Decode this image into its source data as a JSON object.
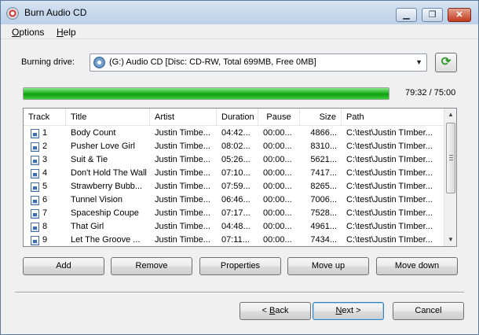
{
  "window": {
    "title": "Burn Audio CD",
    "controls": {
      "minimize": "▁",
      "maximize": "❐",
      "close": "✕"
    }
  },
  "menu": {
    "items": [
      {
        "label": "Options",
        "accel": "O",
        "rest": "ptions"
      },
      {
        "label": "Help",
        "accel": "H",
        "rest": "elp"
      }
    ]
  },
  "drive": {
    "label": "Burning drive:",
    "selected": "(G:) Audio CD [Disc: CD-RW, Total 699MB, Free 0MB]",
    "refresh_icon": "refresh-icon"
  },
  "progress": {
    "fraction": 1.0,
    "time_text": "79:32 / 75:00"
  },
  "tracklist": {
    "columns": [
      "Track",
      "Title",
      "Artist",
      "Duration",
      "Pause",
      "Size",
      "Path"
    ],
    "rows": [
      {
        "track": "1",
        "title": "Body Count",
        "artist": "Justin Timbe...",
        "duration": "04:42...",
        "pause": "00:00...",
        "size": "4866...",
        "path": "C:\\test\\Justin TImber..."
      },
      {
        "track": "2",
        "title": "Pusher Love Girl",
        "artist": "Justin Timbe...",
        "duration": "08:02...",
        "pause": "00:00...",
        "size": "8310...",
        "path": "C:\\test\\Justin TImber..."
      },
      {
        "track": "3",
        "title": "Suit & Tie",
        "artist": "Justin Timbe...",
        "duration": "05:26...",
        "pause": "00:00...",
        "size": "5621...",
        "path": "C:\\test\\Justin TImber..."
      },
      {
        "track": "4",
        "title": "Don't Hold The Wall",
        "artist": "Justin Timbe...",
        "duration": "07:10...",
        "pause": "00:00...",
        "size": "7417...",
        "path": "C:\\test\\Justin TImber..."
      },
      {
        "track": "5",
        "title": "Strawberry Bubb...",
        "artist": "Justin Timbe...",
        "duration": "07:59...",
        "pause": "00:00...",
        "size": "8265...",
        "path": "C:\\test\\Justin TImber..."
      },
      {
        "track": "6",
        "title": "Tunnel Vision",
        "artist": "Justin Timbe...",
        "duration": "06:46...",
        "pause": "00:00...",
        "size": "7006...",
        "path": "C:\\test\\Justin TImber..."
      },
      {
        "track": "7",
        "title": "Spaceship Coupe",
        "artist": "Justin Timbe...",
        "duration": "07:17...",
        "pause": "00:00...",
        "size": "7528...",
        "path": "C:\\test\\Justin TImber..."
      },
      {
        "track": "8",
        "title": "That Girl",
        "artist": "Justin Timbe...",
        "duration": "04:48...",
        "pause": "00:00...",
        "size": "4961...",
        "path": "C:\\test\\Justin TImber..."
      },
      {
        "track": "9",
        "title": "Let The Groove ...",
        "artist": "Justin Timbe...",
        "duration": "07:11...",
        "pause": "00:00...",
        "size": "7434...",
        "path": "C:\\test\\Justin TImber..."
      }
    ]
  },
  "actions": {
    "add": "Add",
    "remove": "Remove",
    "properties": "Properties",
    "move_up": "Move up",
    "move_down": "Move down"
  },
  "footer": {
    "back": {
      "label": "< Back",
      "pre": "< ",
      "accel": "B",
      "rest": "ack"
    },
    "next": {
      "label": "Next >",
      "accel": "N",
      "rest": "ext >"
    },
    "cancel": "Cancel"
  }
}
